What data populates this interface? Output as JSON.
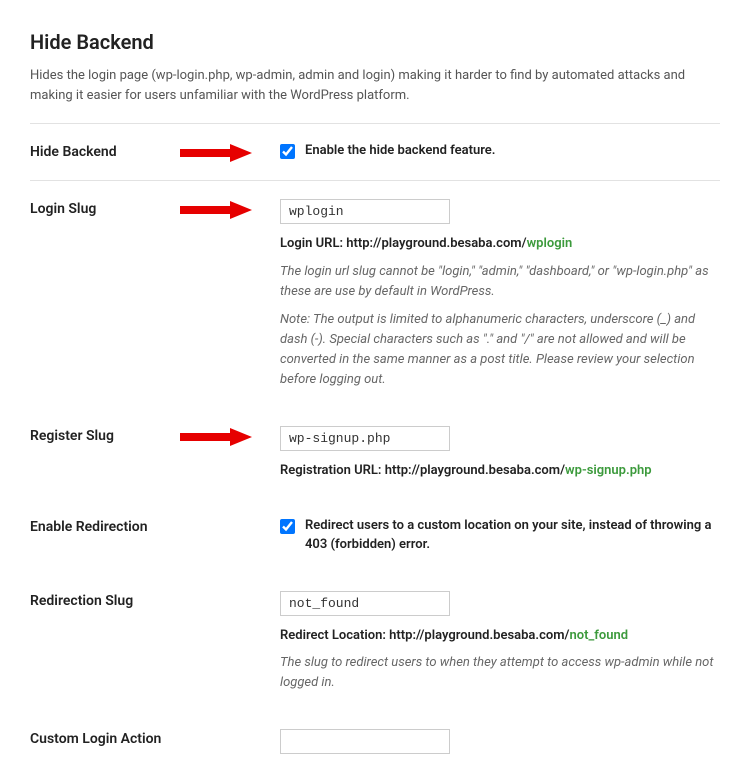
{
  "header": {
    "title": "Hide Backend",
    "description": "Hides the login page (wp-login.php, wp-admin, admin and login) making it harder to find by automated attacks and making it easier for users unfamiliar with the WordPress platform."
  },
  "fields": {
    "hide_backend": {
      "label": "Hide Backend",
      "checkbox_label": "Enable the hide backend feature."
    },
    "login_slug": {
      "label": "Login Slug",
      "value": "wplogin",
      "url_label": "Login URL: ",
      "url_base": "http://playground.besaba.com/",
      "url_slug": "wplogin",
      "help1": "The login url slug cannot be \"login,\" \"admin,\" \"dashboard,\" or \"wp-login.php\" as these are use by default in WordPress.",
      "help2": "Note: The output is limited to alphanumeric characters, underscore (_) and dash (-). Special characters such as \".\" and \"/\" are not allowed and will be converted in the same manner as a post title. Please review your selection before logging out."
    },
    "register_slug": {
      "label": "Register Slug",
      "value": "wp-signup.php",
      "url_label": "Registration URL: ",
      "url_base": "http://playground.besaba.com/",
      "url_slug": "wp-signup.php"
    },
    "enable_redirection": {
      "label": "Enable Redirection",
      "checkbox_label": "Redirect users to a custom location on your site, instead of throwing a 403 (forbidden) error."
    },
    "redirection_slug": {
      "label": "Redirection Slug",
      "value": "not_found",
      "url_label": "Redirect Location: ",
      "url_base": "http://playground.besaba.com/",
      "url_slug": "not_found",
      "help1": "The slug to redirect users to when they attempt to access wp-admin while not logged in."
    },
    "custom_login_action": {
      "label": "Custom Login Action",
      "value": ""
    }
  }
}
